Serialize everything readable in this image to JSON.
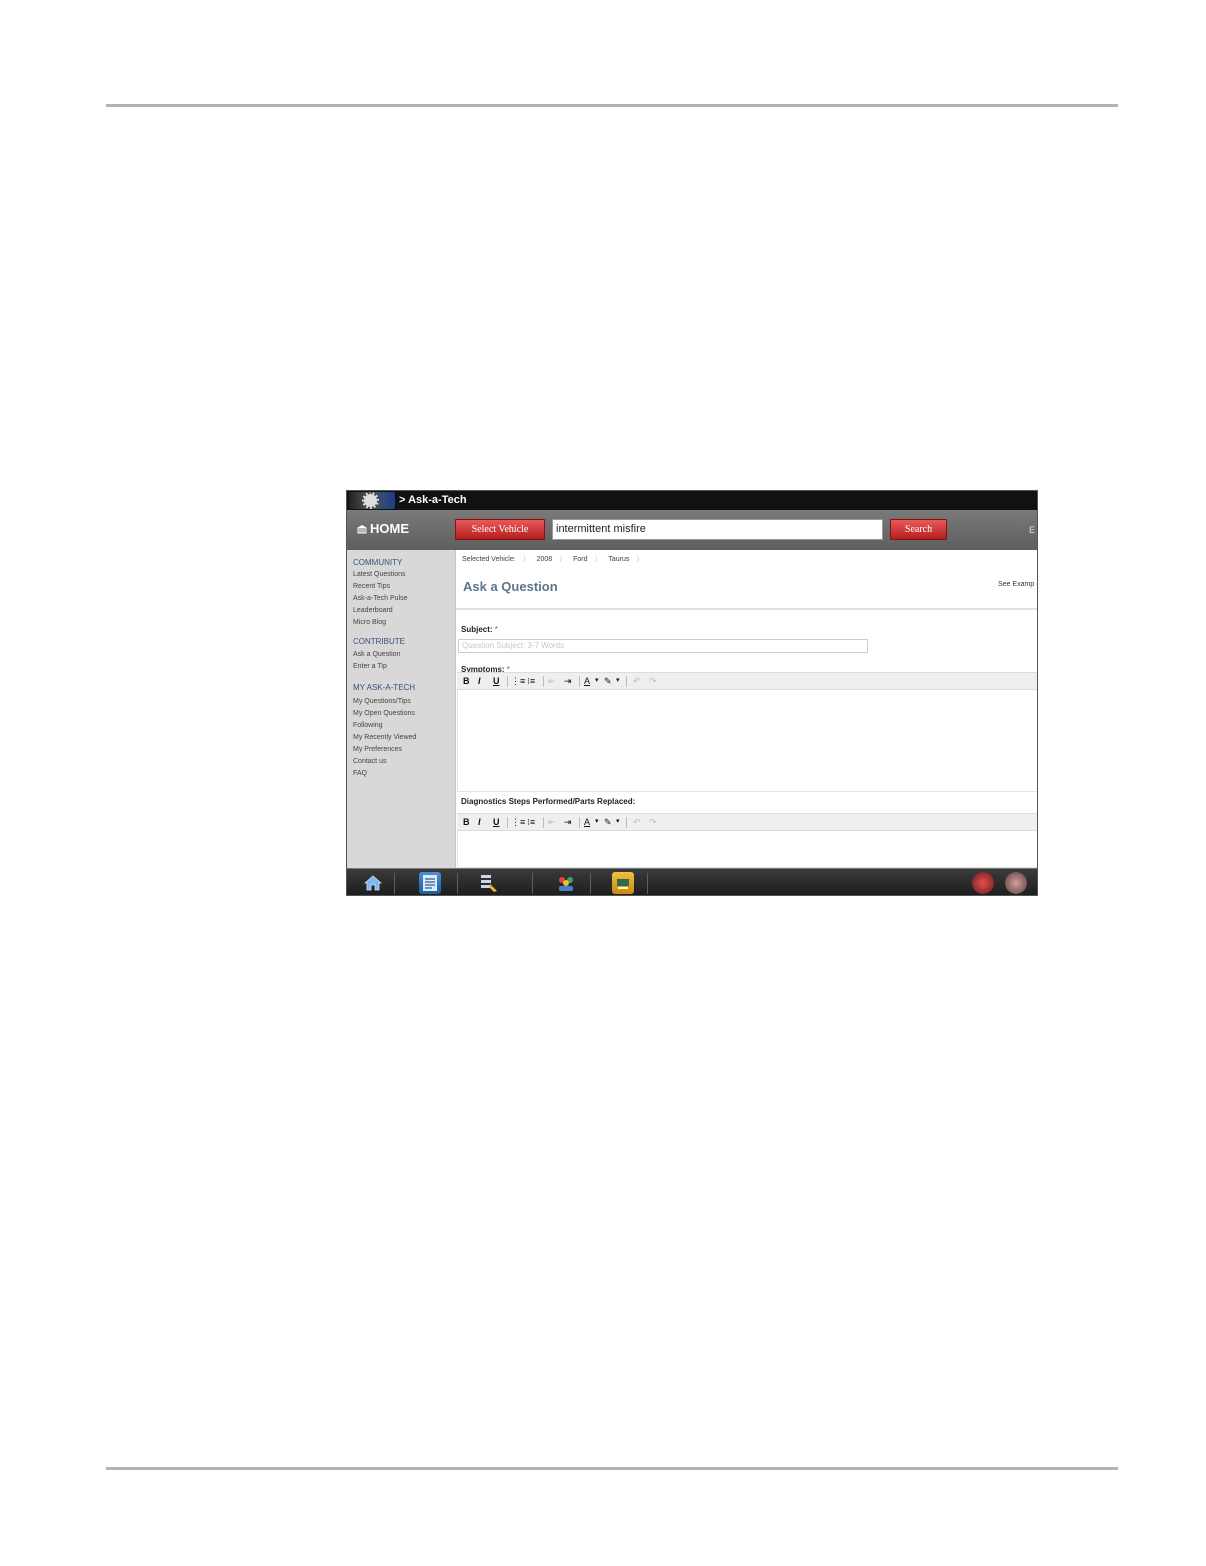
{
  "window": {
    "title": "> Ask-a-Tech"
  },
  "header": {
    "home_label": "HOME",
    "select_vehicle_label": "Select Vehicle",
    "search_value": "intermittent misfire",
    "search_label": "Search",
    "cut_text": "E"
  },
  "sidebar": {
    "community": {
      "heading": "COMMUNITY",
      "items": [
        "Latest Questions",
        "Recent Tips",
        "Ask-a-Tech Pulse",
        "Leaderboard",
        "Micro Blog"
      ]
    },
    "contribute": {
      "heading": "CONTRIBUTE",
      "items": [
        "Ask a Question",
        "Enter a Tip"
      ]
    },
    "my": {
      "heading": "MY ASK-A-TECH",
      "items": [
        "My Questions/Tips",
        "My Open Questions",
        "Following",
        "My Recently Viewed",
        "My Preferences",
        "Contact us",
        "FAQ"
      ]
    }
  },
  "main": {
    "vehicle_label": "Selected Vehicle:",
    "vehicle_year": "2008",
    "vehicle_make": "Ford",
    "vehicle_model": "Taurus",
    "page_title": "Ask a Question",
    "see_example": "See Examp",
    "subject_label": "Subject:",
    "required_mark": "*",
    "subject_placeholder": "Question Subject: 3-7 Words",
    "symptoms_label": "Symptoms:",
    "diagnostics_label": "Diagnostics Steps Performed/Parts Replaced:"
  },
  "toolbar": {
    "bold": "B",
    "italic": "I",
    "underline": "U",
    "ordered_list": "⋮≡",
    "bullet_list": "⁝≡",
    "outdent": "⇤",
    "indent": "⇥",
    "font_color": "A",
    "highlight": "✎",
    "undo": "↶",
    "redo": "↷",
    "dropdown": "▾"
  },
  "colors": {
    "accent_red": "#c62828",
    "title_blue": "#5b7590",
    "header_gray": "#6a6a6a",
    "sidebar_gray": "#d8d8d8"
  },
  "icons": {
    "taskbar": [
      "home-icon",
      "document-icon",
      "system-icon",
      "people-icon",
      "book-icon",
      "wireless-icon",
      "settings-icon"
    ]
  }
}
